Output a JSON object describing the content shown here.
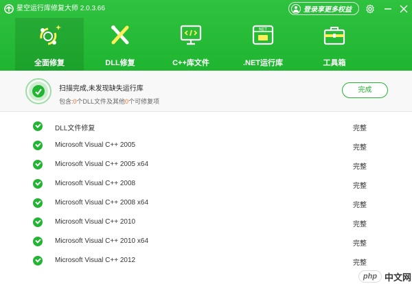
{
  "app": {
    "title": "星空运行库修复大师 2.0.3.66",
    "login_label": "登录享更多权益"
  },
  "tabs": [
    {
      "label": "全面修复",
      "icon": "repair-icon",
      "active": true
    },
    {
      "label": "DLL修复",
      "icon": "dll-tools-icon",
      "active": false
    },
    {
      "label": "C++库文件",
      "icon": "code-monitor-icon",
      "active": false
    },
    {
      "label": ".NET运行库",
      "icon": "net-runtime-icon",
      "active": false
    },
    {
      "label": "工具箱",
      "icon": "toolbox-icon",
      "active": false
    }
  ],
  "status": {
    "title": "扫描完成,未发现缺失运行库",
    "sub_prefix": "包含:",
    "dll_count": "0",
    "sub_middle": "个DLL文件及其他",
    "other_count": "0",
    "sub_suffix": "个可修复项",
    "done_label": "完成"
  },
  "list": [
    {
      "name": "DLL文件修复",
      "state": "完整"
    },
    {
      "name": "Microsoft Visual C++ 2005",
      "state": "完整"
    },
    {
      "name": "Microsoft Visual C++ 2005 x64",
      "state": "完整"
    },
    {
      "name": "Microsoft Visual C++ 2008",
      "state": "完整"
    },
    {
      "name": "Microsoft Visual C++ 2008 x64",
      "state": "完整"
    },
    {
      "name": "Microsoft Visual C++ 2010",
      "state": "完整"
    },
    {
      "name": "Microsoft Visual C++ 2010 x64",
      "state": "完整"
    },
    {
      "name": "Microsoft Visual C++ 2012",
      "state": "完整"
    }
  ],
  "watermark": {
    "badge": "php",
    "text": "中文网"
  },
  "colors": {
    "brand_green": "#22b532",
    "header_green": "#2fc23f",
    "accent_orange": "#ff6a1a"
  }
}
